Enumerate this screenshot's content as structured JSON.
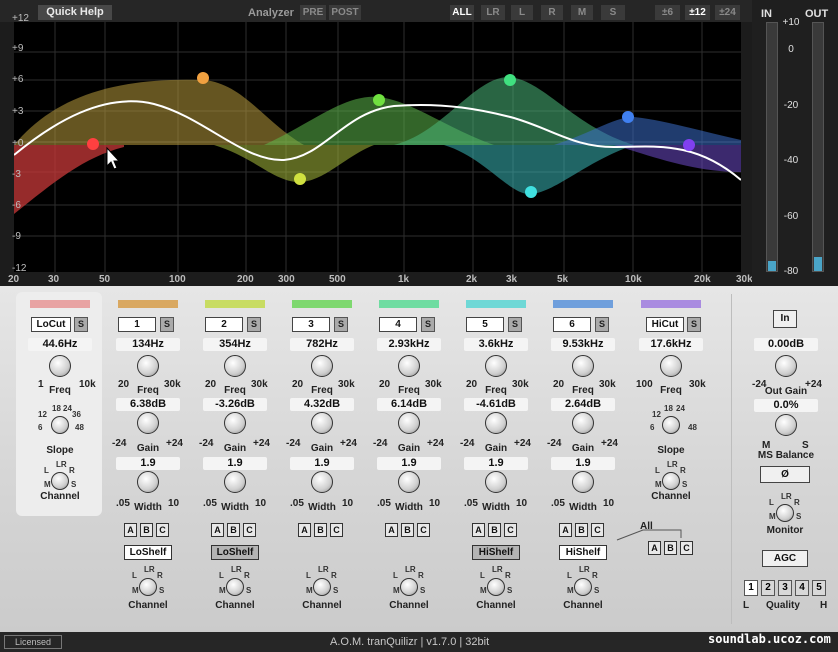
{
  "top": {
    "quick_help": "Quick Help",
    "analyzer": "Analyzer",
    "pre": "PRE",
    "post": "POST",
    "all": "ALL",
    "lr": "LR",
    "l": "L",
    "r": "R",
    "m": "M",
    "s": "S",
    "range_6": "±6",
    "range_12": "±12",
    "range_24": "±24"
  },
  "graph": {
    "y_ticks": [
      "+12",
      "+9",
      "+6",
      "+3",
      "+0",
      "-3",
      "-6",
      "-9",
      "-12"
    ],
    "x_ticks": [
      "20",
      "30",
      "50",
      "100",
      "200",
      "300",
      "500",
      "1k",
      "2k",
      "3k",
      "5k",
      "10k",
      "20k",
      "30k"
    ]
  },
  "meters": {
    "in_label": "IN",
    "out_label": "OUT",
    "scale": [
      "+10",
      "0",
      "-20",
      "-40",
      "-60",
      "-80"
    ]
  },
  "bands": {
    "lowcut": {
      "name": "LoCut",
      "s": "S",
      "color": "#e8a3a3",
      "freq": "44.6Hz",
      "freq_label": "Freq",
      "freq_min": "1",
      "freq_max": "10k",
      "slope_label": "Slope",
      "channel_label": "Channel",
      "slope_ticks": [
        "12",
        "18",
        "24",
        "36",
        "6",
        "48"
      ]
    },
    "eq": [
      {
        "name": "1",
        "s": "S",
        "color": "#d9a861",
        "freq": "134Hz",
        "gain": "6.38dB",
        "width": "1.9",
        "shelf": "LoShelf",
        "shelf_style": "white"
      },
      {
        "name": "2",
        "s": "S",
        "color": "#c8dc63",
        "freq": "354Hz",
        "gain": "-3.26dB",
        "width": "1.9",
        "shelf": "LoShelf",
        "shelf_style": "gray"
      },
      {
        "name": "3",
        "s": "S",
        "color": "#7ed86f",
        "freq": "782Hz",
        "gain": "4.32dB",
        "width": "1.9",
        "shelf": "",
        "shelf_style": "none"
      },
      {
        "name": "4",
        "s": "S",
        "color": "#6fdca1",
        "freq": "2.93kHz",
        "gain": "6.14dB",
        "width": "1.9",
        "shelf": "",
        "shelf_style": "none"
      },
      {
        "name": "5",
        "s": "S",
        "color": "#6fd8d6",
        "freq": "3.6kHz",
        "gain": "-4.61dB",
        "width": "1.9",
        "shelf": "HiShelf",
        "shelf_style": "gray"
      },
      {
        "name": "6",
        "s": "S",
        "color": "#6f9fdc",
        "freq": "9.53kHz",
        "gain": "2.64dB",
        "width": "1.9",
        "shelf": "HiShelf",
        "shelf_style": "white"
      }
    ],
    "hicut": {
      "name": "HiCut",
      "s": "S",
      "color": "#a98be0",
      "freq": "17.6kHz",
      "freq_min": "100",
      "freq_max": "30k",
      "slope_label": "Slope",
      "channel_label": "Channel",
      "slope_ticks": [
        "12",
        "18",
        "24",
        "6",
        "48"
      ]
    }
  },
  "labels": {
    "freq": "Freq",
    "gain": "Gain",
    "width": "Width",
    "channel": "Channel",
    "f20": "20",
    "f30k": "30k",
    "gm": "-24",
    "gp": "+24",
    "w05": ".05",
    "w10": "10",
    "lr": "LR",
    "l": "L",
    "r": "R",
    "m": "M",
    "s": "S",
    "a": "A",
    "b": "B",
    "c": "C",
    "all": "All"
  },
  "right": {
    "in": "In",
    "out_gain": "0.00dB",
    "out_gain_label": "Out Gain",
    "ms_balance": "0.0%",
    "ms_label": "MS Balance",
    "og_min": "-24",
    "og_max": "+24",
    "ms_m": "M",
    "ms_s": "S",
    "phase": "Ø",
    "monitor": "Monitor",
    "agc": "AGC",
    "quality": "Quality",
    "q_l": "L",
    "q_h": "H",
    "quality_buttons": [
      "1",
      "2",
      "3",
      "4",
      "5"
    ],
    "quality_selected": "1"
  },
  "status": {
    "licensed": "Licensed",
    "title": "A.O.M. tranQuilizr | v1.7.0 | 32bit",
    "watermark": "soundlab.ucoz.com"
  }
}
